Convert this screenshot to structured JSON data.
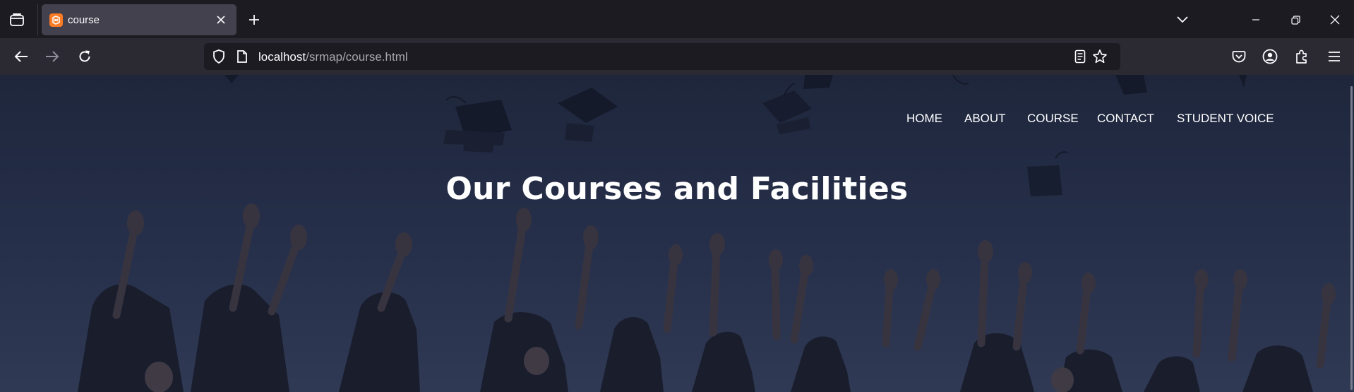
{
  "browser": {
    "tab": {
      "title": "course"
    },
    "url": {
      "host": "localhost",
      "path": "/srmap/course.html"
    }
  },
  "site": {
    "nav": [
      {
        "label": "HOME"
      },
      {
        "label": "ABOUT"
      },
      {
        "label": "COURSE"
      },
      {
        "label": "CONTACT"
      },
      {
        "label": "STUDENT VOICE"
      }
    ],
    "hero_title": "Our Courses and Facilities"
  },
  "colors": {
    "tab_bar": "#1c1b22",
    "nav_bar": "#2b2a33",
    "active_tab": "#42414d",
    "favicon": "#fb7a24",
    "hero_overlay": "#2b3450"
  },
  "icons": [
    "tab-overview-icon",
    "favicon-icon",
    "close-icon",
    "plus-icon",
    "chevron-down-icon",
    "minimize-icon",
    "restore-icon",
    "window-close-icon",
    "back-arrow-icon",
    "forward-arrow-icon",
    "reload-icon",
    "shield-icon",
    "page-icon",
    "reader-view-icon",
    "star-icon",
    "pocket-icon",
    "account-icon",
    "extensions-icon",
    "menu-icon"
  ]
}
